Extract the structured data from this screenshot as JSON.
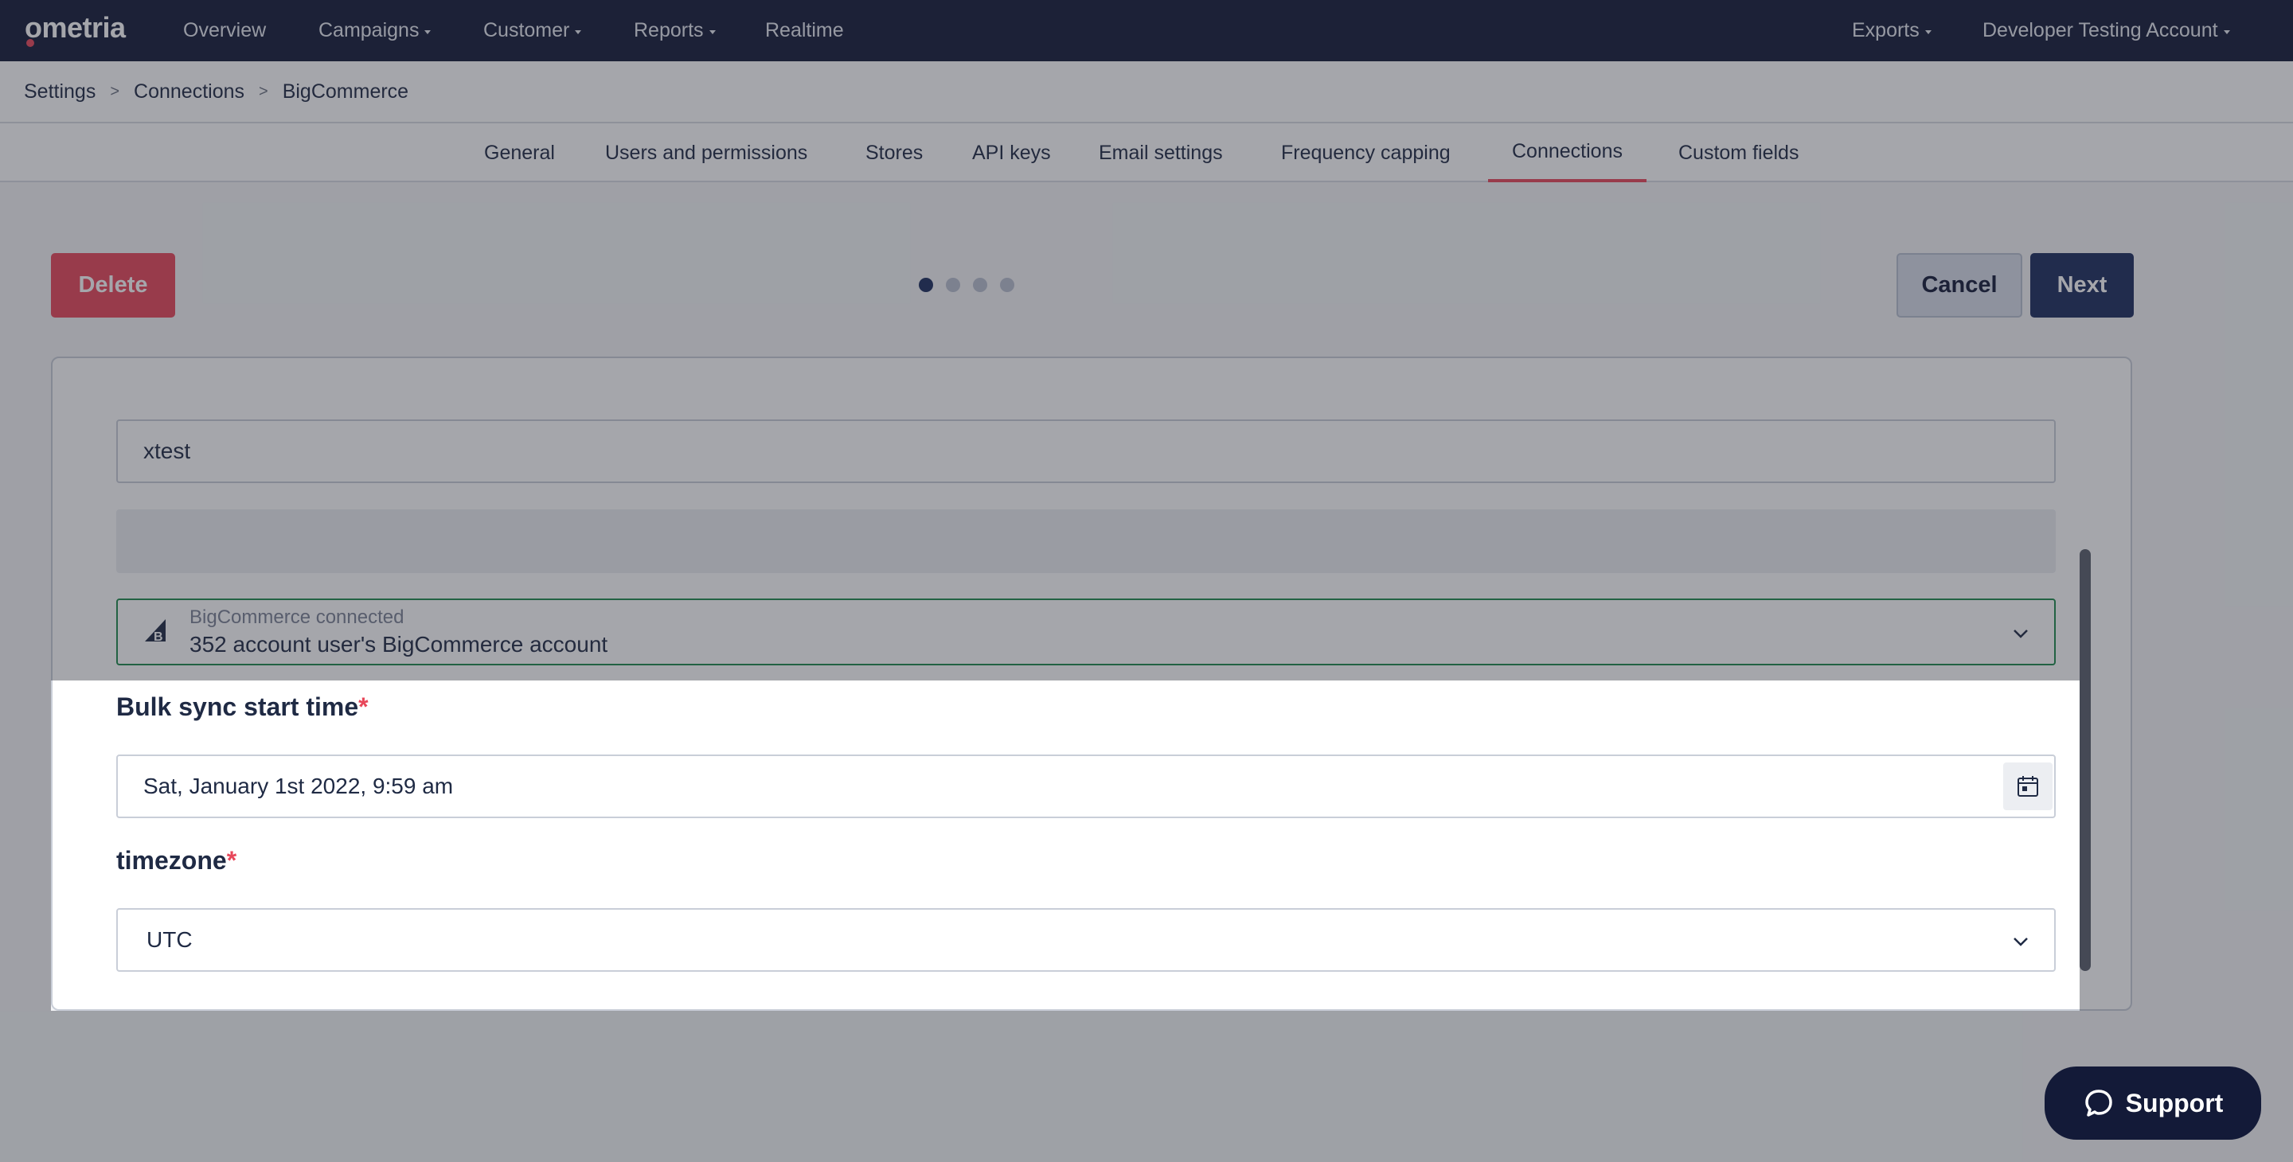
{
  "nav": {
    "logo": "ometria",
    "items": [
      {
        "label": "Overview",
        "dropdown": false
      },
      {
        "label": "Campaigns",
        "dropdown": true
      },
      {
        "label": "Customer",
        "dropdown": true
      },
      {
        "label": "Reports",
        "dropdown": true
      },
      {
        "label": "Realtime",
        "dropdown": false
      }
    ],
    "right_items": [
      {
        "label": "Exports",
        "dropdown": true
      },
      {
        "label": "Developer Testing Account",
        "dropdown": true
      }
    ]
  },
  "breadcrumb": [
    "Settings",
    "Connections",
    "BigCommerce"
  ],
  "tabs": [
    {
      "label": "General",
      "active": false
    },
    {
      "label": "Users and permissions",
      "active": false
    },
    {
      "label": "Stores",
      "active": false
    },
    {
      "label": "API keys",
      "active": false
    },
    {
      "label": "Email settings",
      "active": false
    },
    {
      "label": "Frequency capping",
      "active": false
    },
    {
      "label": "Connections",
      "active": true
    },
    {
      "label": "Custom fields",
      "active": false
    }
  ],
  "actions": {
    "delete_label": "Delete",
    "cancel_label": "Cancel",
    "next_label": "Next"
  },
  "wizard": {
    "steps": 4,
    "current_step": 1
  },
  "form": {
    "name_value": "xtest",
    "connection": {
      "label": "BigCommerce connected",
      "value": "352 account user's BigCommerce account"
    },
    "bulk_sync": {
      "label": "Bulk sync start time",
      "required": "*",
      "value": "Sat, January 1st 2022, 9:59 am"
    },
    "timezone": {
      "label": "timezone",
      "required": "*",
      "value": "UTC"
    }
  },
  "support_label": "Support",
  "colors": {
    "nav_bg": "#131a38",
    "accent": "#e8475a",
    "primary": "#1d2d5e",
    "connected_border": "#1e8a4d"
  }
}
